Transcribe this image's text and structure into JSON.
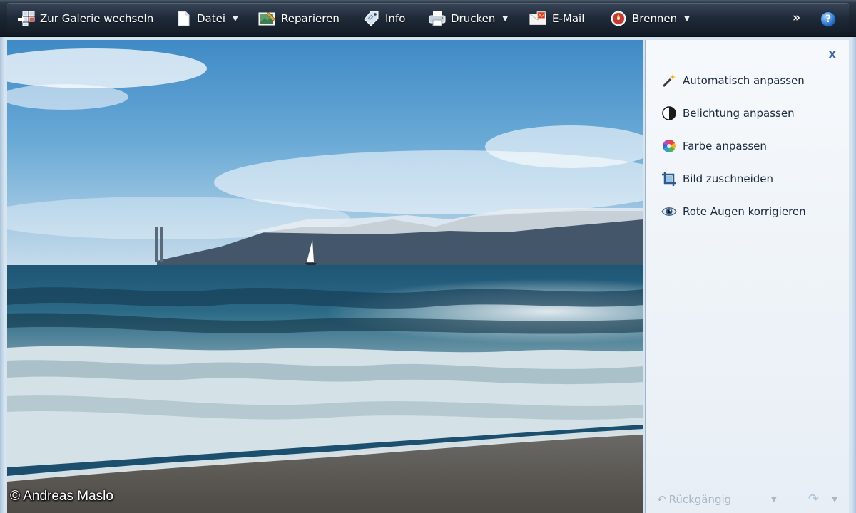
{
  "toolbar": {
    "items": [
      {
        "label": "Zur Galerie wechseln",
        "icon": "gallery-icon",
        "has_menu": false
      },
      {
        "label": "Datei",
        "icon": "file-icon",
        "has_menu": true
      },
      {
        "label": "Reparieren",
        "icon": "repair-icon",
        "has_menu": false
      },
      {
        "label": "Info",
        "icon": "info-tag-icon",
        "has_menu": false
      },
      {
        "label": "Drucken",
        "icon": "printer-icon",
        "has_menu": true
      },
      {
        "label": "E-Mail",
        "icon": "email-icon",
        "has_menu": false
      },
      {
        "label": "Brennen",
        "icon": "burn-disc-icon",
        "has_menu": true
      }
    ],
    "more_symbol": "»",
    "help_symbol": "?",
    "caret_symbol": "▼"
  },
  "panel": {
    "close_symbol": "x",
    "items": [
      {
        "label": "Automatisch anpassen",
        "icon": "magic-wand-icon"
      },
      {
        "label": "Belichtung anpassen",
        "icon": "exposure-icon"
      },
      {
        "label": "Farbe anpassen",
        "icon": "color-wheel-icon"
      },
      {
        "label": "Bild zuschneiden",
        "icon": "crop-icon"
      },
      {
        "label": "Rote Augen korrigieren",
        "icon": "red-eye-icon"
      }
    ],
    "undo_label": "Rückgängig",
    "undo_symbol": "↶",
    "redo_symbol": "↷"
  },
  "photo": {
    "copyright": "© Andreas Maslo"
  },
  "colors": {
    "toolbar_bg": "#1a2430",
    "panel_bg": "#f1f5f9",
    "panel_text": "#1b2b3d",
    "disabled_text": "#a9b6c3"
  }
}
